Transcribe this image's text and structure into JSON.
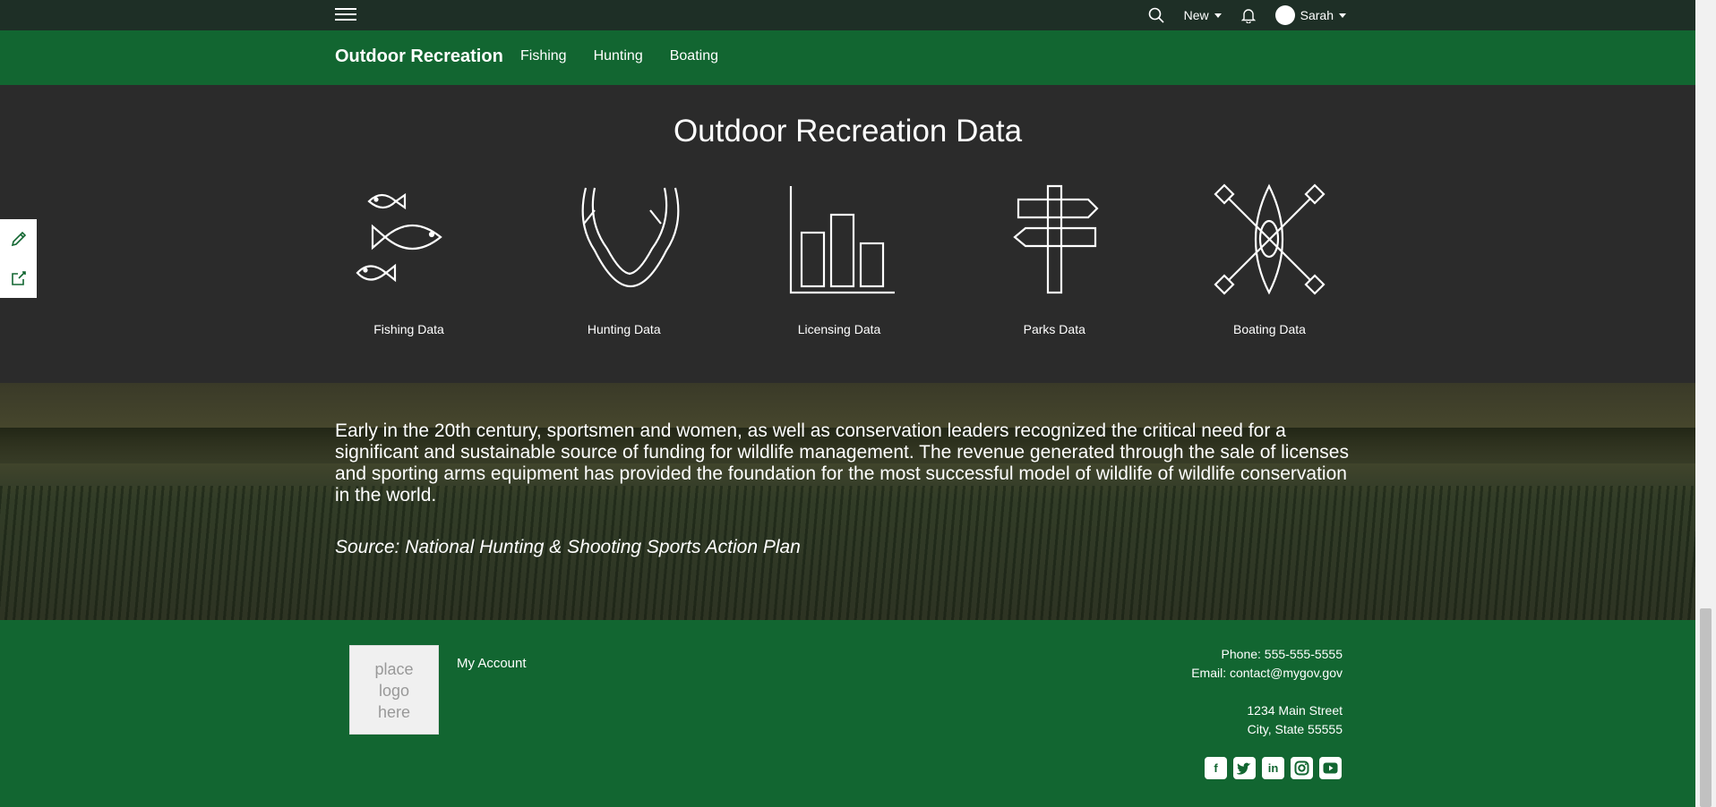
{
  "topbar": {
    "new_label": "New",
    "user_name": "Sarah"
  },
  "nav": {
    "brand": "Outdoor Recreation",
    "links": [
      "Fishing",
      "Hunting",
      "Boating"
    ]
  },
  "data_section": {
    "title": "Outdoor Recreation Data",
    "cards": [
      {
        "label": "Fishing Data",
        "icon": "fish-icon"
      },
      {
        "label": "Hunting Data",
        "icon": "antlers-icon"
      },
      {
        "label": "Licensing Data",
        "icon": "bar-chart-icon"
      },
      {
        "label": "Parks Data",
        "icon": "signpost-icon"
      },
      {
        "label": "Boating Data",
        "icon": "kayak-icon"
      }
    ]
  },
  "hero": {
    "paragraph": "Early in the 20th century, sportsmen and women, as well as conservation leaders recognized the critical need for a significant and sustainable source of funding for wildlife management. The revenue generated through the sale of licenses and sporting arms equipment has provided the foundation for the most successful model of wildlife of wildlife conservation in the world.",
    "source": "Source: National Hunting & Shooting Sports Action Plan"
  },
  "footer": {
    "logo_text": [
      "place",
      "logo",
      "here"
    ],
    "my_account": "My Account",
    "phone": "Phone: 555-555-5555",
    "email": "Email: contact@mygov.gov",
    "address_line1": "1234 Main Street",
    "address_line2": "City, State 55555",
    "social": [
      "facebook-icon",
      "twitter-icon",
      "linkedin-icon",
      "instagram-icon",
      "youtube-icon"
    ]
  },
  "colors": {
    "topbar": "#1e2f26",
    "brand_green": "#126631",
    "dark_bg": "#2b2b2b"
  }
}
